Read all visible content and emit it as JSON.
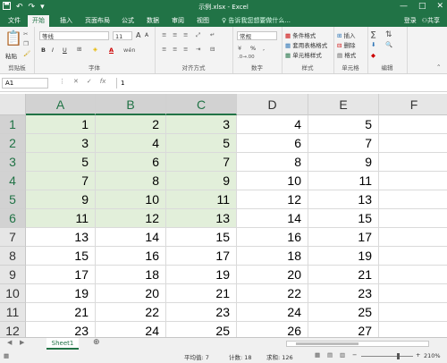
{
  "titlebar": {
    "title": "示例.xlsx - Excel",
    "save_icon": "save-icon",
    "undo_icon": "undo-icon",
    "redo_icon": "redo-icon",
    "win": [
      "—",
      "□",
      "✕"
    ]
  },
  "tabs": [
    "文件",
    "开始",
    "插入",
    "页面布局",
    "公式",
    "数据",
    "审阅",
    "视图"
  ],
  "active_tab": 1,
  "tell_me": "告诉我您想要做什么...",
  "account": {
    "login": "登录",
    "share": "共享"
  },
  "ribbon": {
    "clipboard": {
      "paste": "粘贴",
      "label": "剪贴板"
    },
    "font": {
      "name": "等线",
      "size": "11",
      "bold": "B",
      "italic": "I",
      "underline": "U",
      "grow": "A",
      "shrink": "A",
      "color_a": "A",
      "label": "字体"
    },
    "alignment": {
      "label": "对齐方式"
    },
    "number": {
      "format": "常规",
      "percent": "%",
      "comma": ",",
      "label": "数字"
    },
    "styles": {
      "conditional": "条件格式",
      "table": "套用表格格式",
      "cell": "单元格样式",
      "label": "样式"
    },
    "cells": {
      "insert": "插入",
      "delete": "删除",
      "format": "格式",
      "label": "单元格"
    },
    "editing": {
      "sum": "∑",
      "label": "编辑"
    }
  },
  "formula_bar": {
    "name_box": "A1",
    "cancel": "✕",
    "enter": "✓",
    "fx": "fx",
    "formula": "1"
  },
  "columns": [
    "A",
    "B",
    "C",
    "D",
    "E",
    "F"
  ],
  "rows": [
    {
      "num": "1",
      "cells": [
        "1",
        "2",
        "3",
        "4",
        "5",
        ""
      ]
    },
    {
      "num": "2",
      "cells": [
        "3",
        "4",
        "5",
        "6",
        "7",
        ""
      ]
    },
    {
      "num": "3",
      "cells": [
        "5",
        "6",
        "7",
        "8",
        "9",
        ""
      ]
    },
    {
      "num": "4",
      "cells": [
        "7",
        "8",
        "9",
        "10",
        "11",
        ""
      ]
    },
    {
      "num": "5",
      "cells": [
        "9",
        "10",
        "11",
        "12",
        "13",
        ""
      ]
    },
    {
      "num": "6",
      "cells": [
        "11",
        "12",
        "13",
        "14",
        "15",
        ""
      ]
    },
    {
      "num": "7",
      "cells": [
        "13",
        "14",
        "15",
        "16",
        "17",
        ""
      ]
    },
    {
      "num": "8",
      "cells": [
        "15",
        "16",
        "17",
        "18",
        "19",
        ""
      ]
    },
    {
      "num": "9",
      "cells": [
        "17",
        "18",
        "19",
        "20",
        "21",
        ""
      ]
    },
    {
      "num": "10",
      "cells": [
        "19",
        "20",
        "21",
        "22",
        "23",
        ""
      ]
    },
    {
      "num": "11",
      "cells": [
        "21",
        "22",
        "23",
        "24",
        "25",
        ""
      ]
    },
    {
      "num": "12",
      "cells": [
        "23",
        "24",
        "25",
        "26",
        "27",
        ""
      ]
    }
  ],
  "highlight_color": "#e2efda",
  "accent": "#217346",
  "sheet_tab": "Sheet1",
  "add_sheet": "⊕",
  "status": {
    "average": "平均值: 7",
    "count": "计数: 18",
    "sum": "求和: 126",
    "zoom": "210%",
    "minus": "−",
    "plus": "+"
  }
}
